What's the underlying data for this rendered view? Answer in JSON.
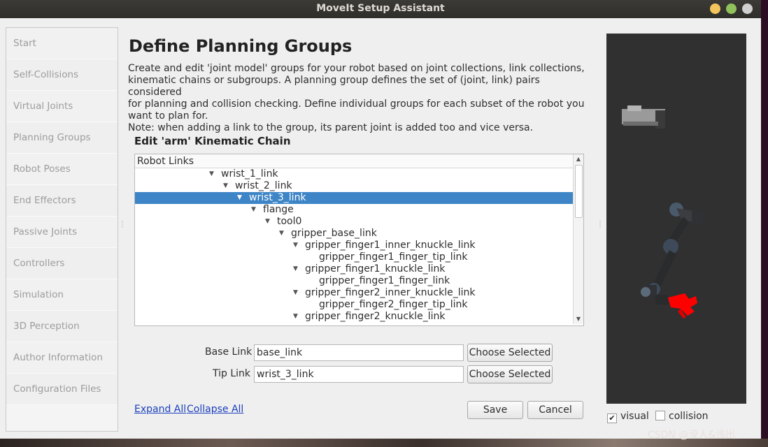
{
  "window": {
    "title": "MoveIt Setup Assistant"
  },
  "sidebar": {
    "items": [
      {
        "label": "Start"
      },
      {
        "label": "Self-Collisions"
      },
      {
        "label": "Virtual Joints"
      },
      {
        "label": "Planning Groups"
      },
      {
        "label": "Robot Poses"
      },
      {
        "label": "End Effectors"
      },
      {
        "label": "Passive Joints"
      },
      {
        "label": "Controllers"
      },
      {
        "label": "Simulation"
      },
      {
        "label": "3D Perception"
      },
      {
        "label": "Author Information"
      },
      {
        "label": "Configuration Files"
      }
    ]
  },
  "main": {
    "title": "Define Planning Groups",
    "description_lines": [
      "Create and edit 'joint model' groups for your robot based on joint collections, link collections,",
      "kinematic chains or subgroups. A planning group defines the set of (joint, link) pairs considered",
      "for planning and collision checking. Define individual groups for each subset of the robot you",
      "want to plan for.",
      "Note: when adding a link to the group, its parent joint is added too and vice versa."
    ],
    "section_title": "Edit 'arm' Kinematic Chain",
    "tree": {
      "header": "Robot Links",
      "rows": [
        {
          "label": "wrist_1_link"
        },
        {
          "label": "wrist_2_link"
        },
        {
          "label": "wrist_3_link"
        },
        {
          "label": "flange"
        },
        {
          "label": "tool0"
        },
        {
          "label": "gripper_base_link"
        },
        {
          "label": "gripper_finger1_inner_knuckle_link"
        },
        {
          "label": "gripper_finger1_finger_tip_link"
        },
        {
          "label": "gripper_finger1_knuckle_link"
        },
        {
          "label": "gripper_finger1_finger_link"
        },
        {
          "label": "gripper_finger2_inner_knuckle_link"
        },
        {
          "label": "gripper_finger2_finger_tip_link"
        },
        {
          "label": "gripper_finger2_knuckle_link"
        }
      ]
    },
    "base_link": {
      "label": "Base Link",
      "value": "base_link",
      "button": "Choose Selected"
    },
    "tip_link": {
      "label": "Tip Link",
      "value": "wrist_3_link",
      "button": "Choose Selected"
    },
    "expand_all": "Expand All",
    "collapse_all": "Collapse All",
    "save": "Save",
    "cancel": "Cancel"
  },
  "viewer": {
    "visual_label": "visual",
    "visual_checked": true,
    "collision_label": "collision",
    "collision_checked": false
  },
  "watermark": "CSDN @没人&浅出",
  "colors": {
    "selection": "#3d85c6",
    "gripper": "#ff0000",
    "link_text": "#1a3fbf"
  }
}
